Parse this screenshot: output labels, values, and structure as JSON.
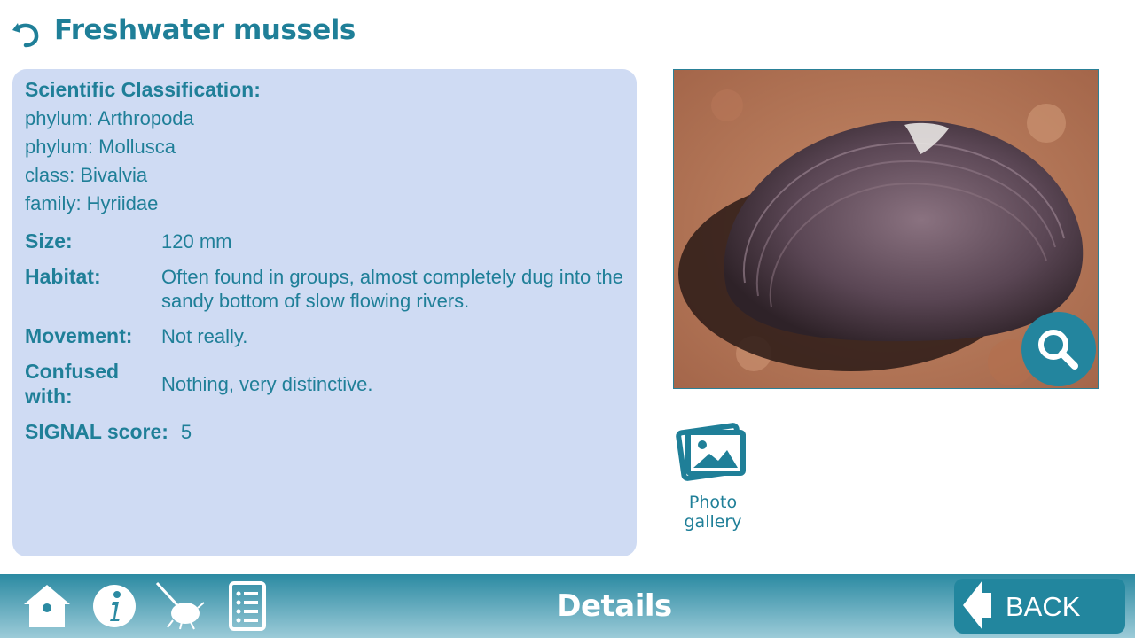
{
  "header": {
    "title": "Freshwater mussels",
    "back_icon": "undo-arrow-icon"
  },
  "classification": {
    "heading": "Scientific Classification:",
    "lines": [
      "phylum: Arthropoda",
      "phylum: Mollusca",
      "class: Bivalvia",
      "family: Hyriidae"
    ]
  },
  "details": {
    "size": {
      "label": "Size:",
      "value": "120 mm"
    },
    "habitat": {
      "label": "Habitat:",
      "value": "Often found in groups, almost completely dug into the sandy bottom of slow flowing rivers."
    },
    "movement": {
      "label": "Movement:",
      "value": "Not really."
    },
    "confused": {
      "label": "Confused with:",
      "value": "Nothing, very distinctive."
    },
    "signal": {
      "label": "SIGNAL score:",
      "value": "5"
    }
  },
  "photo": {
    "subject": "freshwater mussel shell on red soil",
    "zoom_icon": "magnifier-icon"
  },
  "gallery": {
    "label": "Photo gallery",
    "icon": "photos-icon"
  },
  "footer": {
    "title": "Details",
    "nav_icons": [
      "home-icon",
      "info-icon",
      "bug-search-icon",
      "checklist-icon"
    ],
    "back_label": "BACK"
  },
  "colors": {
    "accent": "#1f7f98",
    "panel": "#cfdbf3",
    "footer_top": "#2b8aa2",
    "footer_bottom": "#9ccbd8"
  }
}
